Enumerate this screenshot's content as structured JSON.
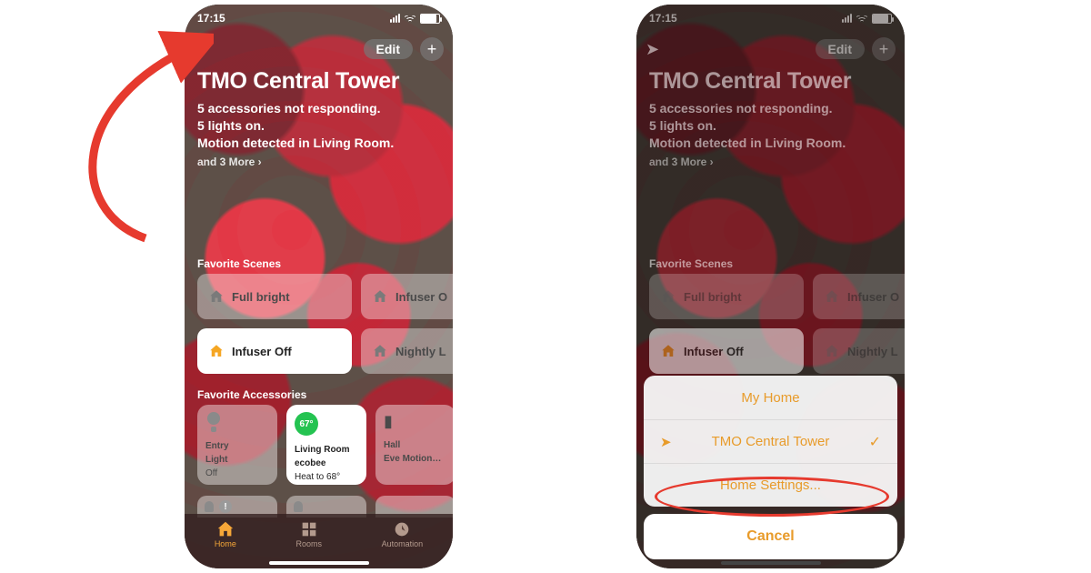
{
  "status": {
    "time": "17:15"
  },
  "topbar": {
    "edit": "Edit"
  },
  "home": {
    "title": "TMO Central Tower",
    "status_line1": "5 accessories not responding.",
    "status_line2": "5 lights on.",
    "status_line3": "Motion detected in Living Room.",
    "more": "and 3 More ›"
  },
  "sections": {
    "scenes": "Favorite Scenes",
    "accessories": "Favorite Accessories"
  },
  "scenes": [
    {
      "label": "Full bright",
      "active": false
    },
    {
      "label": "Infuser O",
      "active": false
    },
    {
      "label": "Infuser Off",
      "active": true
    },
    {
      "label": "Nightly L",
      "active": false
    }
  ],
  "accessories": [
    {
      "line1": "Entry",
      "line2": "Light",
      "line3": "Off",
      "type": "bulb",
      "active": false
    },
    {
      "line1": "Living Room",
      "line2": "ecobee",
      "line3": "Heat to 68°",
      "type": "thermostat",
      "active": true,
      "badge": "67°"
    },
    {
      "line1": "Hall",
      "line2": "Eve Motion…",
      "line3": "",
      "type": "sensor",
      "active": false
    }
  ],
  "tabs": {
    "home": "Home",
    "rooms": "Rooms",
    "automation": "Automation"
  },
  "sheet": {
    "items": [
      "My Home",
      "TMO Central Tower",
      "Home Settings..."
    ],
    "selected_index": 1,
    "cancel": "Cancel"
  }
}
